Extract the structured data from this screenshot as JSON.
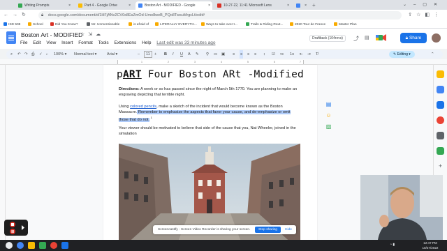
{
  "browser": {
    "tabs": [
      {
        "title": "Writing Prompts",
        "fav": "#34a853"
      },
      {
        "title": "Part 4 - Google Drive",
        "fav": "#fbbc04"
      },
      {
        "title": "Boston Art - MODIFIED - Google",
        "fav": "#4285f4"
      },
      {
        "title": "10-27-22, 11:41 Microsoft Lens",
        "fav": "#d93025"
      },
      {
        "title": "",
        "fav": "#4285f4"
      }
    ],
    "new_tab": "+",
    "url": "docs.google.com/document/d/1HFjANv2CV0x8EsZmOd-Umo8weB_PQo8TwsuMrgcLt/edit#"
  },
  "bookmarks": [
    {
      "label": "ISD 508",
      "color": "#1a73e8"
    },
    {
      "label": "School",
      "color": "#5f6368"
    },
    {
      "label": "Did You Know?",
      "color": "#5f6368"
    },
    {
      "label": "Mr. Unmentionable",
      "color": "#5f6368"
    },
    {
      "label": "is afraid of",
      "color": "#5f6368"
    },
    {
      "label": "LITERALLY EVERYTH...",
      "color": "#5f6368"
    },
    {
      "label": "Ways to take over t...",
      "color": "#5f6368"
    },
    {
      "label": "Trails & Riding Rout...",
      "color": "#5f6368"
    },
    {
      "label": "2020 Tour de France",
      "color": "#5f6368"
    },
    {
      "label": "Master Plan",
      "color": "#5f6368"
    }
  ],
  "docs": {
    "title": "Boston Art - MODIFIED",
    "menus": [
      "File",
      "Edit",
      "View",
      "Insert",
      "Format",
      "Tools",
      "Extensions",
      "Help"
    ],
    "last_edit": "Last edit was 33 minutes ago",
    "draftback": "Draftback (104revs)",
    "share": "Share",
    "mode": "Editing"
  },
  "toolbar": {
    "zoom": "100%",
    "style": "Normal text",
    "font": "Arial",
    "size": "11",
    "bold": "B",
    "italic": "I",
    "underline": "U",
    "text_color": "A"
  },
  "ruler": [
    "1",
    "2",
    "3",
    "4",
    "5",
    "6",
    "7"
  ],
  "document": {
    "heading_prefix": "p",
    "heading_art": "ART",
    "heading_rest": " Four Boston ARt -Modified",
    "directions_label": "Directions:",
    "directions_text": " A week or so has passed since the night of March 5th 1770. You are planning to make an engraving depicting that terrible night.",
    "para2_pre": "Using ",
    "para2_link": "colored pencils",
    "para2_mid": ", make a sketch of the incident that would become known as the Boston Massacre.",
    "para2_highlight": " Remember to emphasize the aspects that favor your cause, and de-emphasize or omit those that do not.",
    "para2_after": "",
    "para2_footnote": "1",
    "para3": "Your viewer should be motivated to believe that side of the cause that you, Nat Wheeler, joined in the simulation"
  },
  "screencastify": {
    "message": "Screencastify - Screen Video Recorder is sharing your screen.",
    "stop": "Stop sharing",
    "hide": "Hide"
  },
  "taskbar": {
    "time": "12:47 PM",
    "date": "10/27/2022"
  }
}
